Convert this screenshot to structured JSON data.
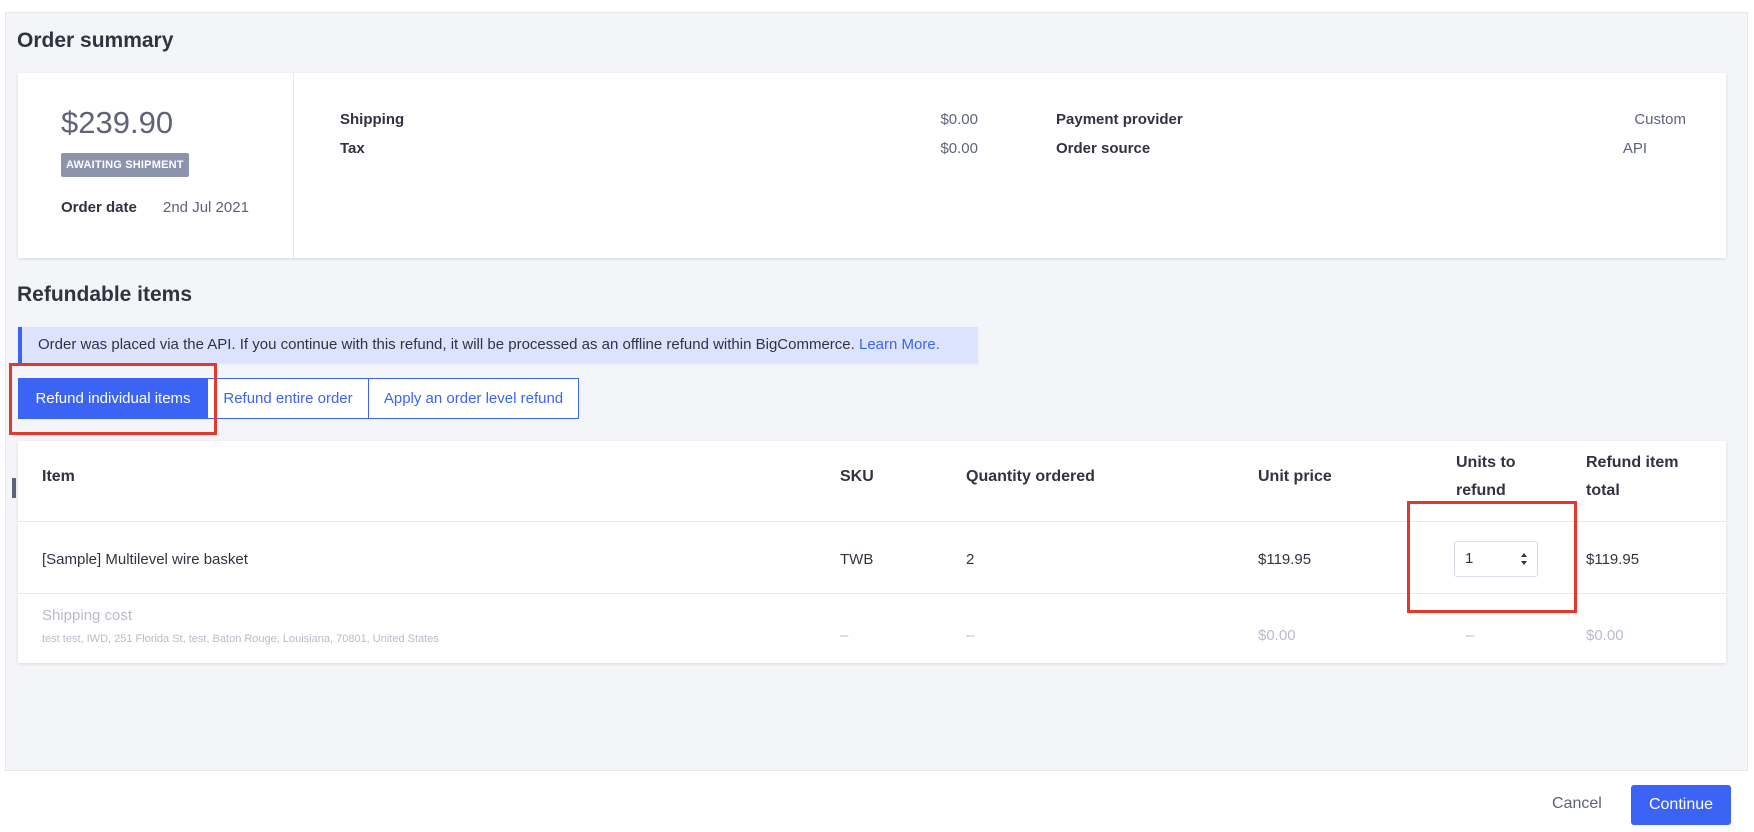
{
  "order_summary": {
    "title": "Order summary",
    "grand_total": "$239.90",
    "status": "AWAITING SHIPMENT",
    "order_date_label": "Order date",
    "order_date": "2nd Jul 2021",
    "shipping_label": "Shipping",
    "shipping_value": "$0.00",
    "tax_label": "Tax",
    "tax_value": "$0.00",
    "payment_provider_label": "Payment provider",
    "payment_provider_value": "Custom",
    "order_source_label": "Order source",
    "order_source_value": "API"
  },
  "refundable": {
    "title": "Refundable items",
    "banner_text": "Order was placed via the API. If you continue with this refund, it will be processed as an offline refund within BigCommerce.",
    "banner_link": "Learn More.",
    "tabs": [
      {
        "label": "Refund individual items",
        "active": true
      },
      {
        "label": "Refund entire order",
        "active": false
      },
      {
        "label": "Apply an order level refund",
        "active": false
      }
    ]
  },
  "table": {
    "headers": {
      "item": "Item",
      "sku": "SKU",
      "qty": "Quantity ordered",
      "unit_price": "Unit price",
      "units_to_refund": "Units to refund",
      "refund_total": "Refund item total"
    },
    "rows": [
      {
        "item": "[Sample] Multilevel wire basket",
        "sku": "TWB",
        "qty": "2",
        "unit_price": "$119.95",
        "units_to_refund": "1",
        "refund_total": "$119.95"
      }
    ],
    "shipping_row": {
      "item": "Shipping cost",
      "address": "test test, IWD, 251 Florida St, test, Baton Rouge, Louisiana, 70801, United States",
      "sku": "–",
      "qty": "–",
      "unit_price": "$0.00",
      "units_to_refund": "–",
      "refund_total": "$0.00"
    }
  },
  "footer": {
    "cancel_label": "Cancel",
    "continue_label": "Continue"
  },
  "colors": {
    "primary": "#3c64f4",
    "highlight": "#e03a2f",
    "badge": "#8c93ad"
  }
}
